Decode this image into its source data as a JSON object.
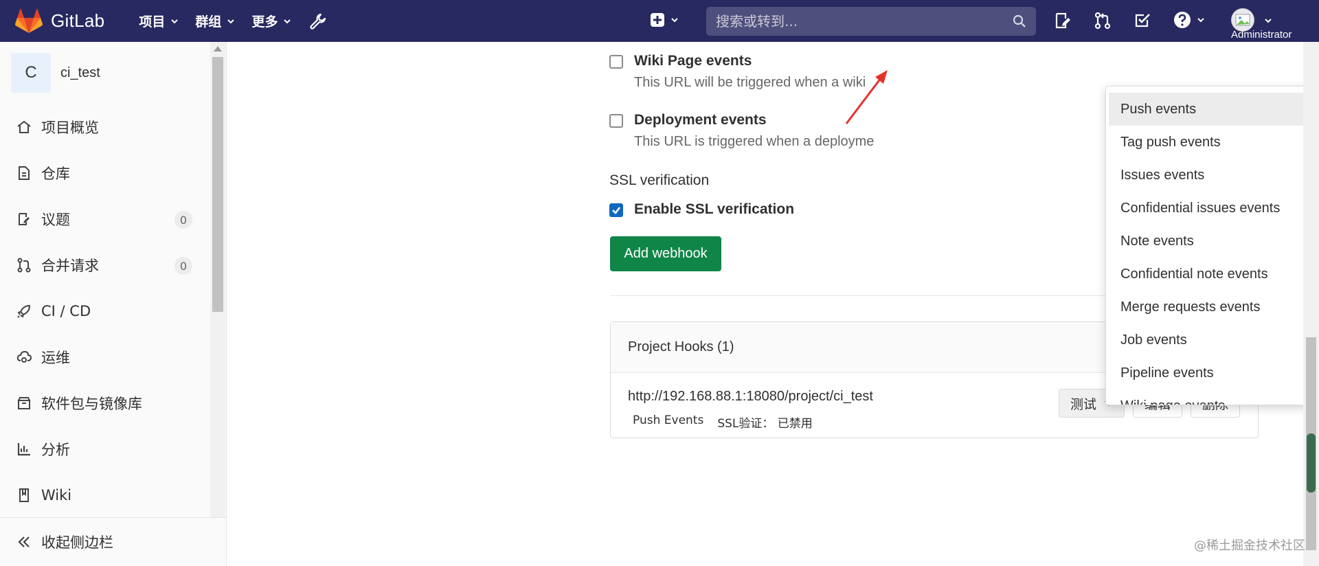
{
  "navbar": {
    "brand": "GitLab",
    "menu": [
      {
        "label": "项目"
      },
      {
        "label": "群组"
      },
      {
        "label": "更多"
      }
    ],
    "search_placeholder": "搜索或转到...",
    "user": "Administrator",
    "colors": {
      "navbar_bg": "#292961",
      "logo": "#fc6d26"
    }
  },
  "sidebar": {
    "project_initial": "C",
    "project_name": "ci_test",
    "items": [
      {
        "label": "项目概览",
        "icon": "home-icon"
      },
      {
        "label": "仓库",
        "icon": "document-icon"
      },
      {
        "label": "议题",
        "icon": "issues-icon",
        "badge": "0"
      },
      {
        "label": "合并请求",
        "icon": "merge-request-icon",
        "badge": "0"
      },
      {
        "label": "CI / CD",
        "icon": "rocket-icon"
      },
      {
        "label": "运维",
        "icon": "cloud-gear-icon"
      },
      {
        "label": "软件包与镜像库",
        "icon": "package-icon"
      },
      {
        "label": "分析",
        "icon": "chart-icon"
      },
      {
        "label": "Wiki",
        "icon": "book-icon"
      }
    ],
    "collapse_label": "收起侧边栏"
  },
  "main": {
    "wiki_events": {
      "title": "Wiki Page events",
      "help": "This URL will be triggered when a wiki"
    },
    "deployment_events": {
      "title": "Deployment events",
      "help": "This URL is triggered when a deployme"
    },
    "ssl_section_label": "SSL verification",
    "ssl_checkbox_label": "Enable SSL verification",
    "add_webhook_label": "Add webhook",
    "project_hooks": {
      "title": "Project Hooks (1)",
      "url": "http://192.168.88.1:18080/project/ci_test",
      "event_tag": "Push Events",
      "ssl_tag": "SSL验证：  已禁用",
      "test_label": "测试",
      "edit_label": "编辑",
      "delete_label": "删除"
    }
  },
  "dropdown": {
    "options": [
      "Push events",
      "Tag push events",
      "Issues events",
      "Confidential issues events",
      "Note events",
      "Confidential note events",
      "Merge requests events",
      "Job events",
      "Pipeline events",
      "Wiki page events"
    ],
    "selected": "Push events"
  },
  "watermark": "@稀土掘金技术社区",
  "accent_colors": {
    "primary_green": "#108548",
    "checkbox_blue": "#1068bf",
    "arrow_red": "#e5322d"
  }
}
